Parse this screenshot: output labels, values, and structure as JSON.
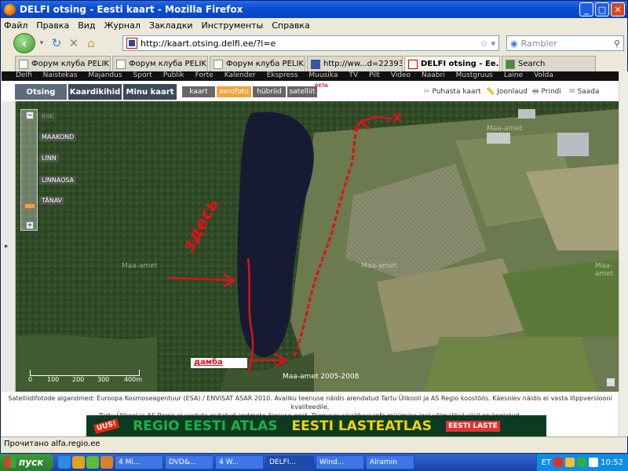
{
  "window": {
    "title": "DELFI otsing - Eesti kaart - Mozilla Firefox",
    "min_symbol": "_",
    "max_symbol": "□",
    "close_symbol": "✕"
  },
  "menu": [
    "Файл",
    "Правка",
    "Вид",
    "Журнал",
    "Закладки",
    "Инструменты",
    "Справка"
  ],
  "nav": {
    "url": "http://kaart.otsing.delfi.ee/?l=e",
    "search_placeholder": "Rambler"
  },
  "tabs": [
    {
      "label": "Форум клуба PELIK..."
    },
    {
      "label": "Форум клуба PELIK..."
    },
    {
      "label": "Форум клуба PELIK..."
    },
    {
      "label": "http://ww...d=223935"
    },
    {
      "label": "DELFI otsing - Ee..."
    },
    {
      "label": "Search"
    }
  ],
  "site_nav": [
    "Delfi",
    "Naistekas",
    "Majandus",
    "Sport",
    "Publik",
    "Forte",
    "Kalender",
    "Ekspress",
    "Muusika",
    "TV",
    "Pilt",
    "Video",
    "Naabri",
    "Mustgruus",
    "Laine",
    "Volda"
  ],
  "map_tabs": [
    "Otsing",
    "Kaardikihid",
    "Minu kaart"
  ],
  "layers": [
    "kaart",
    "aerofoto",
    "hübriid",
    "satelliit"
  ],
  "beta_label": "BETA",
  "actions": [
    "Puhasta kaart",
    "Joonlaud",
    "Prindi",
    "Saada"
  ],
  "zoom_levels": [
    "RIIK",
    "MAAKOND",
    "LINN",
    "LINNAOSA",
    "TÄNAV"
  ],
  "map_annotations": {
    "handwritten": "здесь",
    "dam_label": "дамба",
    "watermarks": [
      "Maa-amet",
      "Maa-amet",
      "Maa-amet",
      "Maa-amet"
    ],
    "copyright": "Maa-amet 2005-2008"
  },
  "scale": [
    "0",
    "100",
    "200",
    "300",
    "400m"
  ],
  "credits": [
    "Satelliidifotode algandmed: Euroopa Kosmoseagentuur (ESA) / ENVISAT ASAR 2010. Avaliku teenuse näidis arendatud Tartu Ülikooli ja AS Regio koostöös. Käesolev näidis ei vasta lõppversiooni kvaliteedile,",
    "Tartu Ülikool ja AS Regio ei vastuta esitatud andmete õigsuse eest. Teenuses sisalduva info müümine igal võimalikul viisil on keelatud."
  ],
  "banner": {
    "badge": "UUS!",
    "text1": "REGIO EESTI ATLAS",
    "text2": "EESTI LASTEATLAS",
    "tag": "EESTI LASTE"
  },
  "status": "Прочитано alfa.regio.ee",
  "taskbar": {
    "start": "пуск",
    "tasks": [
      "4 Mi...",
      "DVD&...",
      "4 W...",
      "DELFI...",
      "Wind...",
      "Alramin"
    ],
    "lang": "ET",
    "time": "10:52"
  },
  "colors": {
    "titlebar": "#0a4fd6",
    "accent_layer": "#f2a23a",
    "annotation_red": "#e0101a"
  }
}
